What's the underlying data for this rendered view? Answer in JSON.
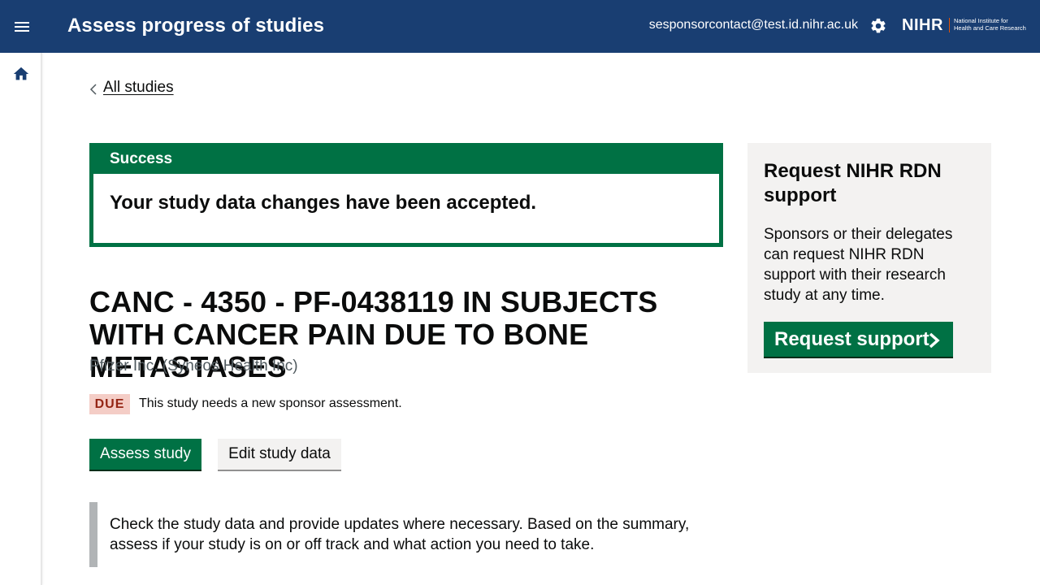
{
  "header": {
    "title": "Assess progress of studies",
    "user_email": "sesponsorcontact@test.id.nihr.ac.uk",
    "logo": {
      "name": "NIHR",
      "tagline_line1": "National Institute for",
      "tagline_line2": "Health and Care Research"
    },
    "icons": {
      "menu": "menu-icon",
      "settings": "gear-icon"
    }
  },
  "sidenav": {
    "icons": {
      "home": "home-icon"
    }
  },
  "breadcrumb": {
    "back_label": "All studies"
  },
  "banner": {
    "title": "Success",
    "message": "Your study data changes have been accepted."
  },
  "study": {
    "title": "CANC - 4350 - PF-0438119 IN SUBJECTS WITH CANCER PAIN DUE TO BONE METASTASES",
    "sponsor": "Pfizer Inc. (Syneos Health Inc)",
    "status_tag": "DUE",
    "status_text": "This study needs a new sponsor assessment.",
    "assess_button": "Assess study",
    "edit_button": "Edit study data",
    "inset_text": "Check the study data and provide updates where necessary. Based on the summary, assess if your study is on or off track and what action you need to take."
  },
  "support_panel": {
    "title": "Request NIHR RDN support",
    "body": "Sponsors or their delegates can request NIHR RDN support with their research study at any time.",
    "button_label": "Request support"
  },
  "colors": {
    "header_bg": "#193e72",
    "brand_green": "#007144",
    "due_tag_bg": "#f4cdc6",
    "due_tag_text": "#942514",
    "panel_bg": "#f3f2f1"
  }
}
